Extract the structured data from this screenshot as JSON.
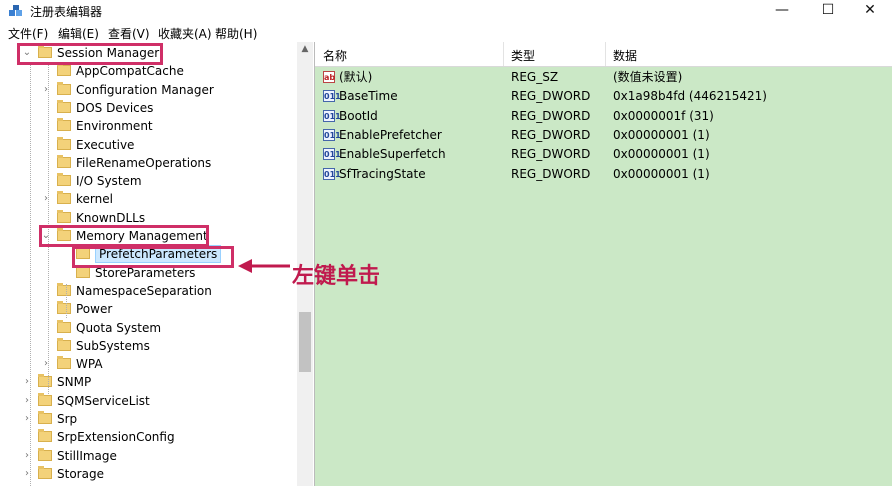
{
  "window": {
    "title": "注册表编辑器",
    "min_glyph": "—",
    "max_glyph": "☐",
    "close_glyph": "✕"
  },
  "menu": [
    "文件(F)",
    "编辑(E)",
    "查看(V)",
    "收藏夹(A)",
    "帮助(H)"
  ],
  "tree": [
    {
      "label": "Session Manager",
      "expander": "⌄",
      "selected": false,
      "highlighted": true
    },
    {
      "label": "AppCompatCache",
      "expander": ""
    },
    {
      "label": "Configuration Manager",
      "expander": "›"
    },
    {
      "label": "DOS Devices",
      "expander": ""
    },
    {
      "label": "Environment",
      "expander": ""
    },
    {
      "label": "Executive",
      "expander": ""
    },
    {
      "label": "FileRenameOperations",
      "expander": ""
    },
    {
      "label": "I/O System",
      "expander": ""
    },
    {
      "label": "kernel",
      "expander": "›"
    },
    {
      "label": "KnownDLLs",
      "expander": ""
    },
    {
      "label": "Memory Management",
      "expander": "⌄",
      "highlighted": true
    },
    {
      "label": "PrefetchParameters",
      "expander": "",
      "selected": true,
      "highlighted": true
    },
    {
      "label": "StoreParameters",
      "expander": ""
    },
    {
      "label": "NamespaceSeparation",
      "expander": ""
    },
    {
      "label": "Power",
      "expander": ""
    },
    {
      "label": "Quota System",
      "expander": ""
    },
    {
      "label": "SubSystems",
      "expander": ""
    },
    {
      "label": "WPA",
      "expander": "›"
    },
    {
      "label": "SNMP",
      "expander": "›"
    },
    {
      "label": "SQMServiceList",
      "expander": "›"
    },
    {
      "label": "Srp",
      "expander": "›"
    },
    {
      "label": "SrpExtensionConfig",
      "expander": ""
    },
    {
      "label": "StillImage",
      "expander": "›"
    },
    {
      "label": "Storage",
      "expander": "›"
    }
  ],
  "list": {
    "headers": {
      "name": "名称",
      "type": "类型",
      "data": "数据"
    },
    "rows": [
      {
        "icon": "ab",
        "icon_name": "string-value-icon",
        "name": "(默认)",
        "type": "REG_SZ",
        "data": "(数值未设置)"
      },
      {
        "icon": "011",
        "icon_name": "dword-value-icon",
        "name": "BaseTime",
        "type": "REG_DWORD",
        "data": "0x1a98b4fd (446215421)"
      },
      {
        "icon": "011",
        "icon_name": "dword-value-icon",
        "name": "BootId",
        "type": "REG_DWORD",
        "data": "0x0000001f (31)"
      },
      {
        "icon": "011",
        "icon_name": "dword-value-icon",
        "name": "EnablePrefetcher",
        "type": "REG_DWORD",
        "data": "0x00000001 (1)"
      },
      {
        "icon": "011",
        "icon_name": "dword-value-icon",
        "name": "EnableSuperfetch",
        "type": "REG_DWORD",
        "data": "0x00000001 (1)"
      },
      {
        "icon": "011",
        "icon_name": "dword-value-icon",
        "name": "SfTracingState",
        "type": "REG_DWORD",
        "data": "0x00000001 (1)"
      }
    ]
  },
  "annotation": {
    "text": "左键单击",
    "color": "#c01a4e"
  },
  "colors": {
    "list_background": "#cbe8c6",
    "highlight_box": "#cf2f67",
    "selection": "#cce8ff"
  }
}
